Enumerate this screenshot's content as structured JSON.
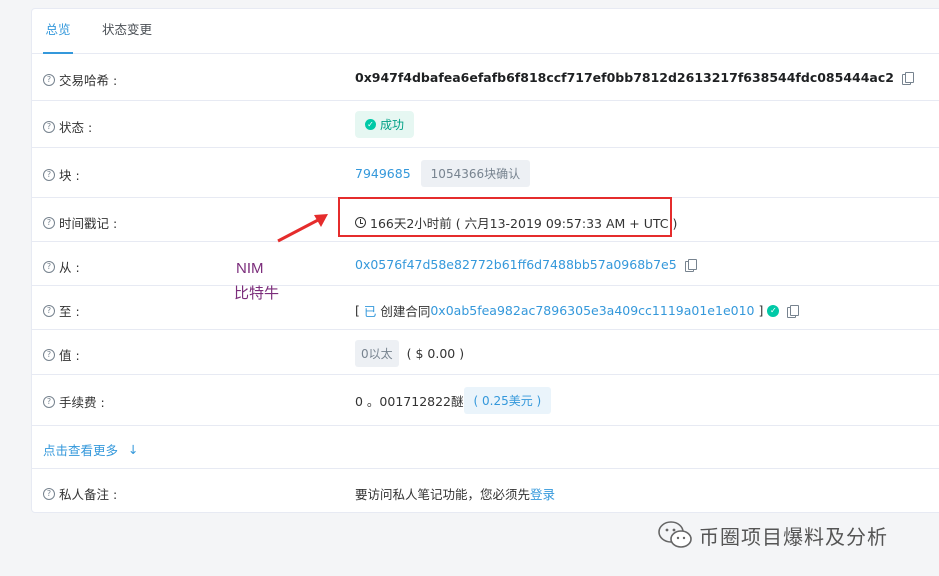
{
  "tabs": [
    {
      "label": "总览",
      "active": true
    },
    {
      "label": "状态变更",
      "active": false
    }
  ],
  "rows": {
    "tx_hash": {
      "label": "交易哈希 :",
      "value": "0x947f4dbafea6efafb6f818ccf717ef0bb7812d2613217f638544fdc085444ac2"
    },
    "status": {
      "label": "状态 :",
      "value": "成功"
    },
    "block": {
      "label": "块 :",
      "value": "7949685",
      "confirmations": "1054366块确认"
    },
    "timestamp": {
      "label": "时间戳记 :",
      "value": "166天2小时前 ( 六月13-2019 09:57:33 AM + UTC )"
    },
    "from": {
      "label": "从 :",
      "value": "0x0576f47d58e82772b61ff6d7488bb57a0968b7e5"
    },
    "to": {
      "label": "至 :",
      "prefix": "[ ",
      "created": "已",
      "created_text": " 创建合同",
      "contract": "0x0ab5fea982ac7896305e3a409cc1119a01e1e010",
      "suffix": " ]"
    },
    "value": {
      "label": "值 :",
      "amount": "0以太",
      "usd": "( $ 0.00 )"
    },
    "fee": {
      "label": "手续费 :",
      "amount": "0 。001712822醚",
      "usd": "( 0.25美元 )"
    },
    "more": {
      "label": "点击查看更多"
    },
    "note": {
      "label": "私人备注 :",
      "text": "要访问私人笔记功能，您必须先",
      "login": "登录"
    }
  },
  "annotation": {
    "line1": "NIM",
    "line2": "比特牛"
  },
  "watermark": {
    "text": "币圈项目爆料及分析"
  },
  "colors": {
    "accent": "#3498db",
    "success": "#00c9a7",
    "highlight": "#e52c2c",
    "annotation": "#7b2d7b"
  }
}
